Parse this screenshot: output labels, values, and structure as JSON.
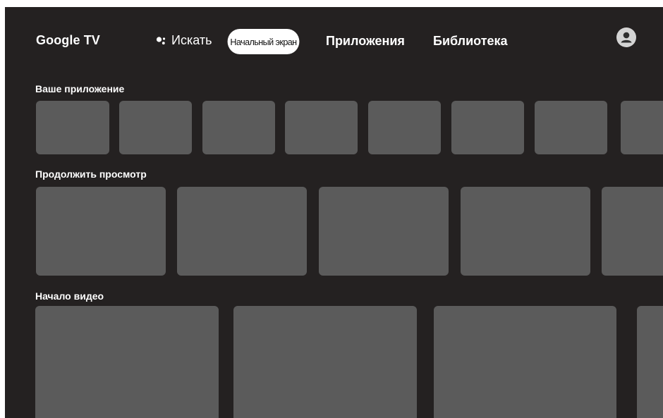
{
  "nav": {
    "brand": "Google TV",
    "search_label": "Искать",
    "home_label": "Начальный экран",
    "apps_label": "Приложения",
    "library_label": "Библиотека",
    "search_icon": "google-assistant-icon",
    "account_icon": "account-avatar-icon"
  },
  "sections": [
    {
      "title": "Ваше приложение",
      "card_count": 8
    },
    {
      "title": "Продолжить просмотр",
      "card_count": 5
    },
    {
      "title": "Начало видео",
      "card_count": 4
    }
  ],
  "colors": {
    "background": "#242121",
    "card": "#5b5b5b",
    "selected_tab": "#ffffff",
    "text": "#ffffff"
  }
}
